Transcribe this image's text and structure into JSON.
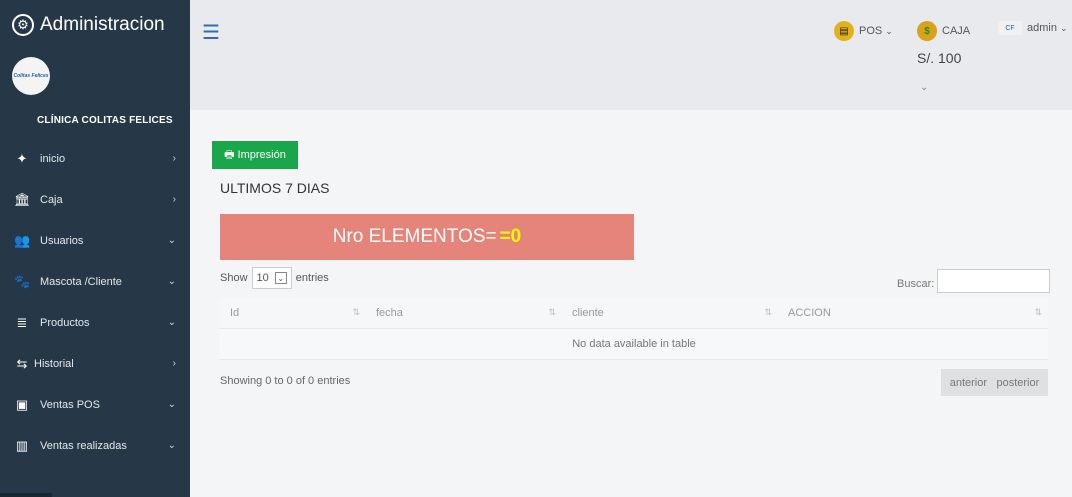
{
  "app": {
    "title": "Administracion",
    "clinic_name": "CLÍNICA COLITAS FELICES",
    "logo_text": "Colitas Felices"
  },
  "sidebar": {
    "items": [
      {
        "label": "inicio",
        "icon": "dashboard-icon",
        "glyph": "✦",
        "chevron": "›"
      },
      {
        "label": "Caja",
        "icon": "bank-icon",
        "glyph": "🏛",
        "chevron": "›"
      },
      {
        "label": "Usuarios",
        "icon": "users-icon",
        "glyph": "👥",
        "chevron": "⌄"
      },
      {
        "label": "Mascota /Cliente",
        "icon": "pet-client-icon",
        "glyph": "🐾",
        "chevron": "⌄"
      },
      {
        "label": "Productos",
        "icon": "database-icon",
        "glyph": "≣",
        "chevron": "⌄"
      },
      {
        "label": "Historial",
        "icon": "exchange-icon",
        "glyph": "⇆",
        "chevron": "›"
      },
      {
        "label": "Ventas POS",
        "icon": "money-icon",
        "glyph": "▣",
        "chevron": "⌄"
      },
      {
        "label": "Ventas realizadas",
        "icon": "bar-chart-icon",
        "glyph": "▥",
        "chevron": "⌄"
      }
    ]
  },
  "header": {
    "pos_label": "POS",
    "caja_label": "CAJA",
    "caja_amount": "S/. 100",
    "user_label": "admin",
    "dropdown_chevron": "⌄"
  },
  "main": {
    "print_label": "Impresión",
    "range_title": "ULTIMOS 7 DIAS",
    "banner_text": "Nro ELEMENTOS= ",
    "banner_value": "=0",
    "show_label": "Show",
    "entries_value": "10",
    "entries_label": "entries",
    "search_label": "Buscar:",
    "columns": [
      "Id",
      "fecha",
      "cliente",
      "ACCION"
    ],
    "empty_text": "No data available in table",
    "info_text": "Showing 0 to 0 of 0 entries",
    "prev_label": "anterior",
    "next_label": "posterior"
  },
  "colors": {
    "sidebar": "#263847",
    "print_button": "#1aa64a",
    "banner": "#e4847a",
    "banner_value": "#fffa00",
    "header": "#e9eaed"
  }
}
